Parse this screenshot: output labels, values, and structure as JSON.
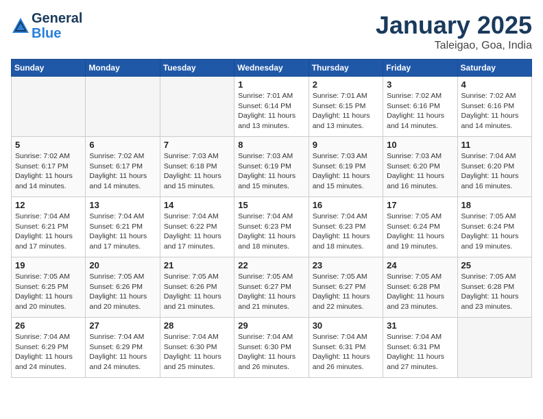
{
  "header": {
    "logo_line1": "General",
    "logo_line2": "Blue",
    "month_title": "January 2025",
    "location": "Taleigao, Goa, India"
  },
  "weekdays": [
    "Sunday",
    "Monday",
    "Tuesday",
    "Wednesday",
    "Thursday",
    "Friday",
    "Saturday"
  ],
  "weeks": [
    [
      {
        "day": "",
        "sunrise": "",
        "sunset": "",
        "daylight": "",
        "empty": true
      },
      {
        "day": "",
        "sunrise": "",
        "sunset": "",
        "daylight": "",
        "empty": true
      },
      {
        "day": "",
        "sunrise": "",
        "sunset": "",
        "daylight": "",
        "empty": true
      },
      {
        "day": "1",
        "sunrise": "Sunrise: 7:01 AM",
        "sunset": "Sunset: 6:14 PM",
        "daylight": "Daylight: 11 hours and 13 minutes."
      },
      {
        "day": "2",
        "sunrise": "Sunrise: 7:01 AM",
        "sunset": "Sunset: 6:15 PM",
        "daylight": "Daylight: 11 hours and 13 minutes."
      },
      {
        "day": "3",
        "sunrise": "Sunrise: 7:02 AM",
        "sunset": "Sunset: 6:16 PM",
        "daylight": "Daylight: 11 hours and 14 minutes."
      },
      {
        "day": "4",
        "sunrise": "Sunrise: 7:02 AM",
        "sunset": "Sunset: 6:16 PM",
        "daylight": "Daylight: 11 hours and 14 minutes."
      }
    ],
    [
      {
        "day": "5",
        "sunrise": "Sunrise: 7:02 AM",
        "sunset": "Sunset: 6:17 PM",
        "daylight": "Daylight: 11 hours and 14 minutes."
      },
      {
        "day": "6",
        "sunrise": "Sunrise: 7:02 AM",
        "sunset": "Sunset: 6:17 PM",
        "daylight": "Daylight: 11 hours and 14 minutes."
      },
      {
        "day": "7",
        "sunrise": "Sunrise: 7:03 AM",
        "sunset": "Sunset: 6:18 PM",
        "daylight": "Daylight: 11 hours and 15 minutes."
      },
      {
        "day": "8",
        "sunrise": "Sunrise: 7:03 AM",
        "sunset": "Sunset: 6:19 PM",
        "daylight": "Daylight: 11 hours and 15 minutes."
      },
      {
        "day": "9",
        "sunrise": "Sunrise: 7:03 AM",
        "sunset": "Sunset: 6:19 PM",
        "daylight": "Daylight: 11 hours and 15 minutes."
      },
      {
        "day": "10",
        "sunrise": "Sunrise: 7:03 AM",
        "sunset": "Sunset: 6:20 PM",
        "daylight": "Daylight: 11 hours and 16 minutes."
      },
      {
        "day": "11",
        "sunrise": "Sunrise: 7:04 AM",
        "sunset": "Sunset: 6:20 PM",
        "daylight": "Daylight: 11 hours and 16 minutes."
      }
    ],
    [
      {
        "day": "12",
        "sunrise": "Sunrise: 7:04 AM",
        "sunset": "Sunset: 6:21 PM",
        "daylight": "Daylight: 11 hours and 17 minutes."
      },
      {
        "day": "13",
        "sunrise": "Sunrise: 7:04 AM",
        "sunset": "Sunset: 6:21 PM",
        "daylight": "Daylight: 11 hours and 17 minutes."
      },
      {
        "day": "14",
        "sunrise": "Sunrise: 7:04 AM",
        "sunset": "Sunset: 6:22 PM",
        "daylight": "Daylight: 11 hours and 17 minutes."
      },
      {
        "day": "15",
        "sunrise": "Sunrise: 7:04 AM",
        "sunset": "Sunset: 6:23 PM",
        "daylight": "Daylight: 11 hours and 18 minutes."
      },
      {
        "day": "16",
        "sunrise": "Sunrise: 7:04 AM",
        "sunset": "Sunset: 6:23 PM",
        "daylight": "Daylight: 11 hours and 18 minutes."
      },
      {
        "day": "17",
        "sunrise": "Sunrise: 7:05 AM",
        "sunset": "Sunset: 6:24 PM",
        "daylight": "Daylight: 11 hours and 19 minutes."
      },
      {
        "day": "18",
        "sunrise": "Sunrise: 7:05 AM",
        "sunset": "Sunset: 6:24 PM",
        "daylight": "Daylight: 11 hours and 19 minutes."
      }
    ],
    [
      {
        "day": "19",
        "sunrise": "Sunrise: 7:05 AM",
        "sunset": "Sunset: 6:25 PM",
        "daylight": "Daylight: 11 hours and 20 minutes."
      },
      {
        "day": "20",
        "sunrise": "Sunrise: 7:05 AM",
        "sunset": "Sunset: 6:26 PM",
        "daylight": "Daylight: 11 hours and 20 minutes."
      },
      {
        "day": "21",
        "sunrise": "Sunrise: 7:05 AM",
        "sunset": "Sunset: 6:26 PM",
        "daylight": "Daylight: 11 hours and 21 minutes."
      },
      {
        "day": "22",
        "sunrise": "Sunrise: 7:05 AM",
        "sunset": "Sunset: 6:27 PM",
        "daylight": "Daylight: 11 hours and 21 minutes."
      },
      {
        "day": "23",
        "sunrise": "Sunrise: 7:05 AM",
        "sunset": "Sunset: 6:27 PM",
        "daylight": "Daylight: 11 hours and 22 minutes."
      },
      {
        "day": "24",
        "sunrise": "Sunrise: 7:05 AM",
        "sunset": "Sunset: 6:28 PM",
        "daylight": "Daylight: 11 hours and 23 minutes."
      },
      {
        "day": "25",
        "sunrise": "Sunrise: 7:05 AM",
        "sunset": "Sunset: 6:28 PM",
        "daylight": "Daylight: 11 hours and 23 minutes."
      }
    ],
    [
      {
        "day": "26",
        "sunrise": "Sunrise: 7:04 AM",
        "sunset": "Sunset: 6:29 PM",
        "daylight": "Daylight: 11 hours and 24 minutes."
      },
      {
        "day": "27",
        "sunrise": "Sunrise: 7:04 AM",
        "sunset": "Sunset: 6:29 PM",
        "daylight": "Daylight: 11 hours and 24 minutes."
      },
      {
        "day": "28",
        "sunrise": "Sunrise: 7:04 AM",
        "sunset": "Sunset: 6:30 PM",
        "daylight": "Daylight: 11 hours and 25 minutes."
      },
      {
        "day": "29",
        "sunrise": "Sunrise: 7:04 AM",
        "sunset": "Sunset: 6:30 PM",
        "daylight": "Daylight: 11 hours and 26 minutes."
      },
      {
        "day": "30",
        "sunrise": "Sunrise: 7:04 AM",
        "sunset": "Sunset: 6:31 PM",
        "daylight": "Daylight: 11 hours and 26 minutes."
      },
      {
        "day": "31",
        "sunrise": "Sunrise: 7:04 AM",
        "sunset": "Sunset: 6:31 PM",
        "daylight": "Daylight: 11 hours and 27 minutes."
      },
      {
        "day": "",
        "sunrise": "",
        "sunset": "",
        "daylight": "",
        "empty": true
      }
    ]
  ]
}
